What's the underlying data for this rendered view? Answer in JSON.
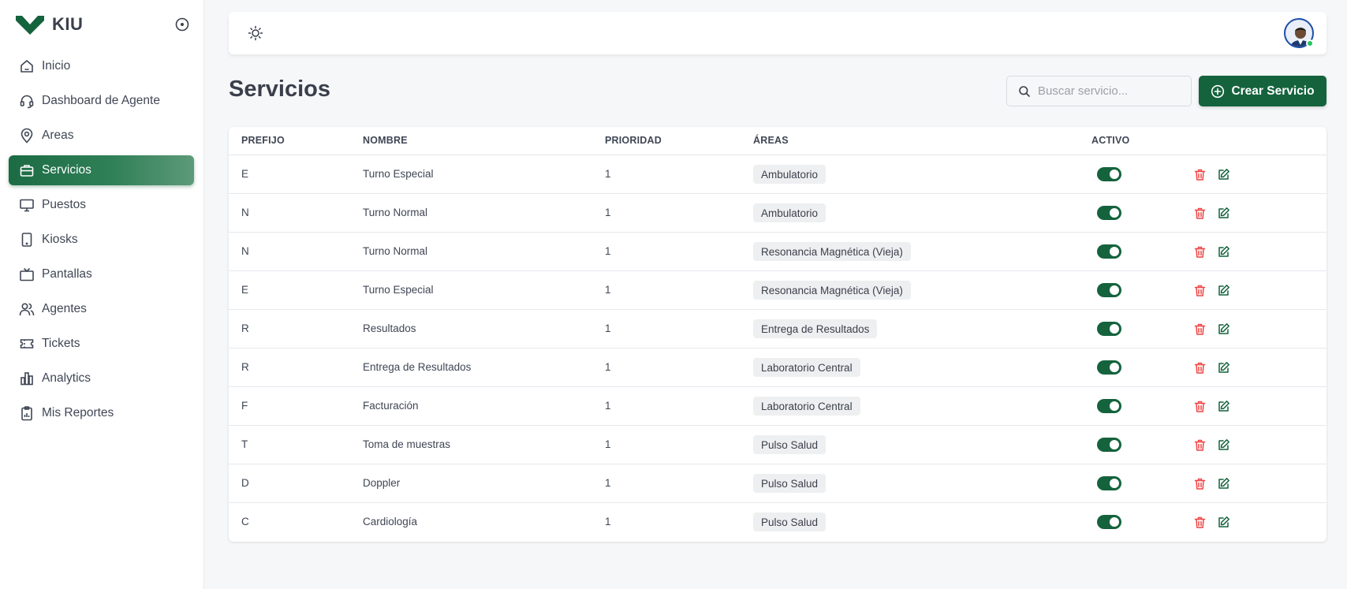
{
  "brand": {
    "name": "KIU",
    "color": "#14633d"
  },
  "sidebar": {
    "items": [
      {
        "label": "Inicio",
        "icon": "home-icon",
        "active": false
      },
      {
        "label": "Dashboard de Agente",
        "icon": "headset-icon",
        "active": false
      },
      {
        "label": "Areas",
        "icon": "map-pin-icon",
        "active": false
      },
      {
        "label": "Servicios",
        "icon": "briefcase-icon",
        "active": true
      },
      {
        "label": "Puestos",
        "icon": "monitor-icon",
        "active": false
      },
      {
        "label": "Kiosks",
        "icon": "tablet-icon",
        "active": false
      },
      {
        "label": "Pantallas",
        "icon": "tv-icon",
        "active": false
      },
      {
        "label": "Agentes",
        "icon": "users-icon",
        "active": false
      },
      {
        "label": "Tickets",
        "icon": "ticket-icon",
        "active": false
      },
      {
        "label": "Analytics",
        "icon": "bar-chart-icon",
        "active": false
      },
      {
        "label": "Mis Reportes",
        "icon": "clipboard-report-icon",
        "active": false
      }
    ]
  },
  "header": {
    "title": "Servicios"
  },
  "search": {
    "placeholder": "Buscar servicio...",
    "value": ""
  },
  "actions": {
    "create_label": "Crear Servicio"
  },
  "table": {
    "columns": {
      "prefix": "PREFIJO",
      "name": "NOMBRE",
      "priority": "PRIORIDAD",
      "areas": "ÁREAS",
      "active": "ACTIVO"
    },
    "rows": [
      {
        "prefix": "E",
        "name": "Turno Especial",
        "priority": "1",
        "area": "Ambulatorio",
        "active": true
      },
      {
        "prefix": "N",
        "name": "Turno Normal",
        "priority": "1",
        "area": "Ambulatorio",
        "active": true
      },
      {
        "prefix": "N",
        "name": "Turno Normal",
        "priority": "1",
        "area": "Resonancia Magnética (Vieja)",
        "active": true
      },
      {
        "prefix": "E",
        "name": "Turno Especial",
        "priority": "1",
        "area": "Resonancia Magnética (Vieja)",
        "active": true
      },
      {
        "prefix": "R",
        "name": "Resultados",
        "priority": "1",
        "area": "Entrega de Resultados",
        "active": true
      },
      {
        "prefix": "R",
        "name": "Entrega de Resultados",
        "priority": "1",
        "area": "Laboratorio Central",
        "active": true
      },
      {
        "prefix": "F",
        "name": "Facturación",
        "priority": "1",
        "area": "Laboratorio Central",
        "active": true
      },
      {
        "prefix": "T",
        "name": "Toma de muestras",
        "priority": "1",
        "area": "Pulso Salud",
        "active": true
      },
      {
        "prefix": "D",
        "name": "Doppler",
        "priority": "1",
        "area": "Pulso Salud",
        "active": true
      },
      {
        "prefix": "C",
        "name": "Cardiología",
        "priority": "1",
        "area": "Pulso Salud",
        "active": true
      }
    ]
  },
  "colors": {
    "accent": "#14633d",
    "delete": "#ef4444",
    "online": "#22c55e"
  }
}
